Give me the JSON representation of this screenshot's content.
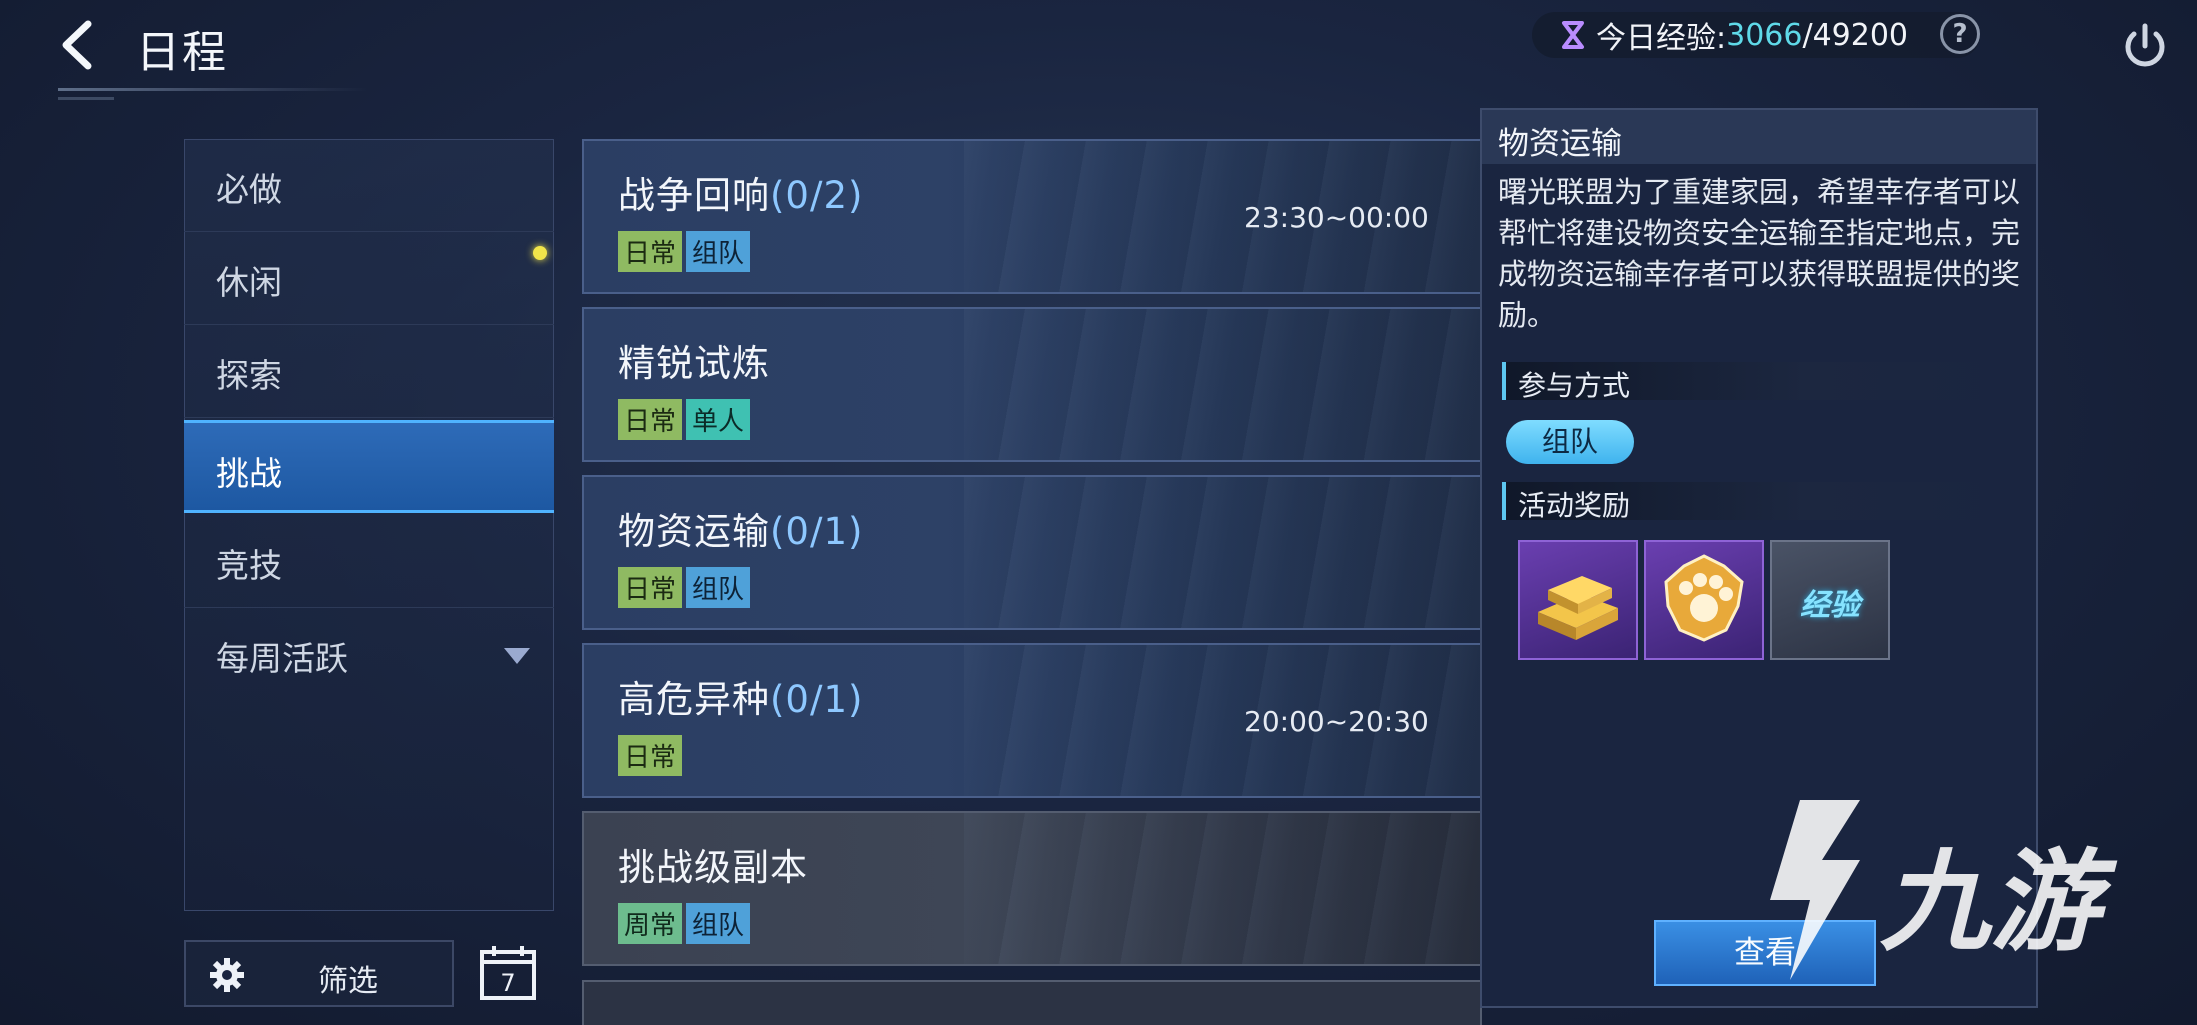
{
  "header": {
    "title": "日程",
    "exp_label": "今日经验:",
    "exp_current": "3066",
    "exp_max": "/49200",
    "help_label": "?"
  },
  "sidebar": {
    "items": [
      {
        "label": "必做"
      },
      {
        "label": "休闲"
      },
      {
        "label": "探索"
      },
      {
        "label": "挑战"
      },
      {
        "label": "竞技"
      },
      {
        "label": "每周活跃"
      }
    ],
    "active_index": 3,
    "filter_label": "筛选",
    "calendar_day": "7"
  },
  "activities": [
    {
      "name": "战争回响",
      "count": "(0/2)",
      "tags": [
        "日常",
        "组队"
      ],
      "time": "23:30~00:00"
    },
    {
      "name": "精锐试炼",
      "count": "",
      "tags": [
        "日常",
        "单人"
      ],
      "time": ""
    },
    {
      "name": "物资运输",
      "count": "(0/1)",
      "tags": [
        "日常",
        "组队"
      ],
      "time": ""
    },
    {
      "name": "高危异种",
      "count": "(0/1)",
      "tags": [
        "日常"
      ],
      "time": "20:00~20:30"
    },
    {
      "name": "挑战级副本",
      "count": "",
      "tags": [
        "周常",
        "组队"
      ],
      "time": ""
    }
  ],
  "detail": {
    "title": "物资运输",
    "description": "曙光联盟为了重建家园，希望幸存者可以帮忙将建设物资安全运输至指定地点，完成物资运输幸存者可以获得联盟提供的奖励。",
    "participation_header": "参与方式",
    "participation_mode": "组队",
    "rewards_header": "活动奖励",
    "rewards": [
      {
        "icon": "gold-bars-icon"
      },
      {
        "icon": "paw-badge-icon"
      },
      {
        "icon": "exp-icon",
        "text": "经验"
      }
    ],
    "view_button": "查看"
  },
  "watermark": {
    "text": "九游"
  }
}
